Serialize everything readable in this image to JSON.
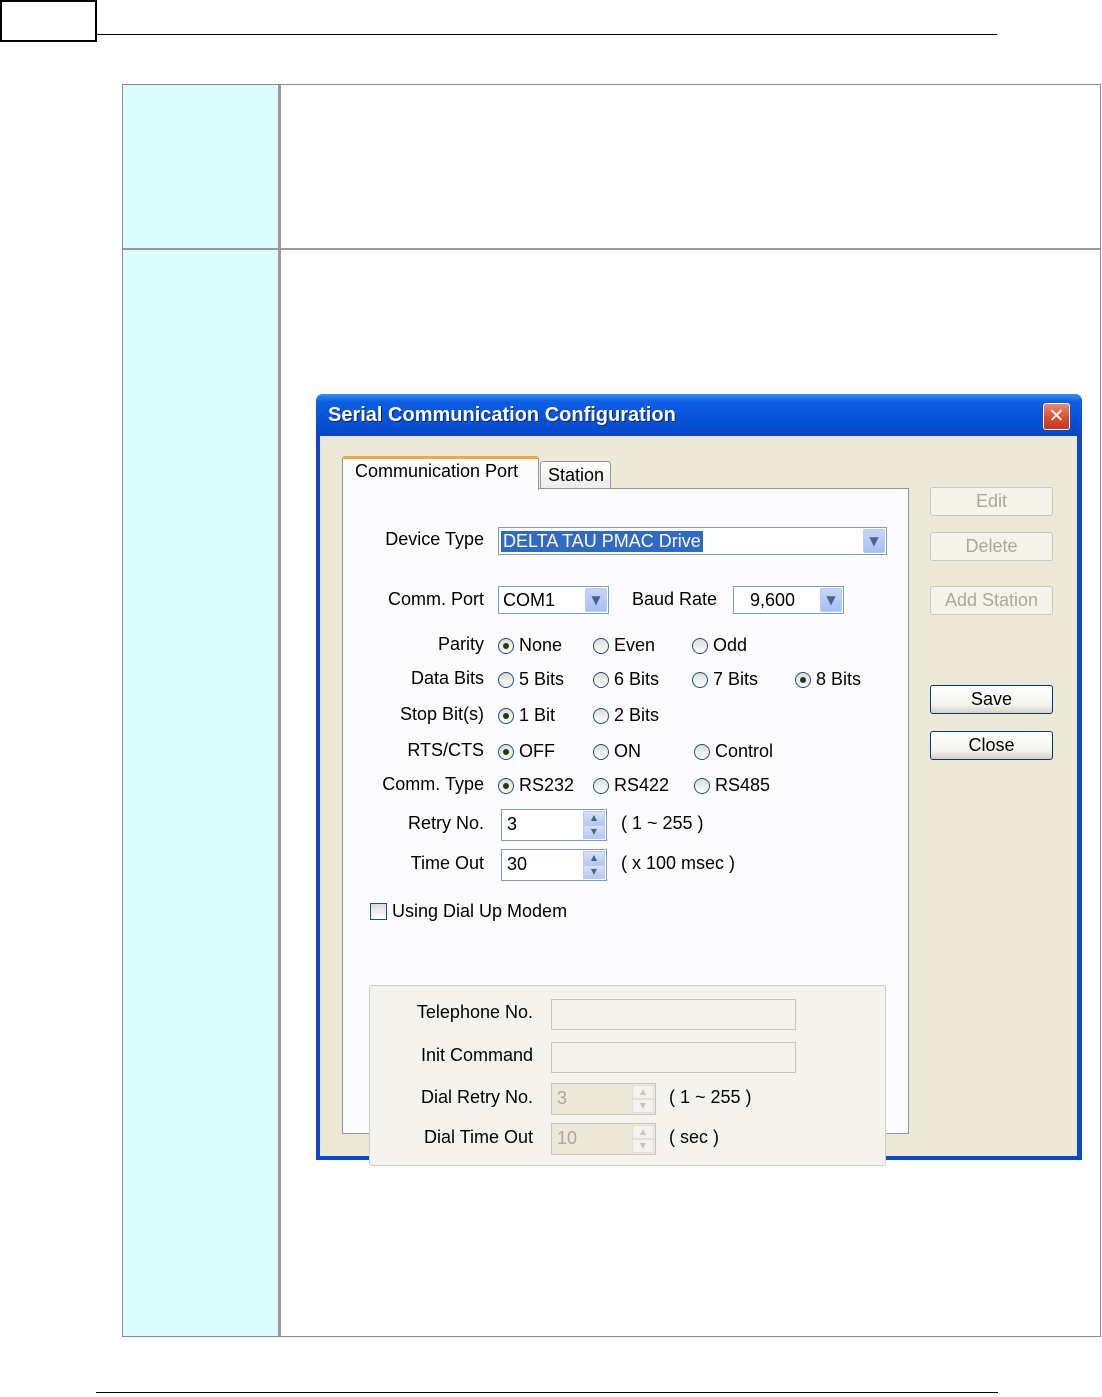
{
  "dialog": {
    "title": "Serial Communication Configuration",
    "close_glyph": "✕",
    "tabs": [
      "Communication Port",
      "Station"
    ],
    "device_type": {
      "label": "Device Type",
      "value": "DELTA TAU PMAC Drive"
    },
    "comm_port": {
      "label": "Comm. Port",
      "value": "COM1"
    },
    "baud_rate": {
      "label": "Baud Rate",
      "value": "9,600"
    },
    "parity": {
      "label": "Parity",
      "options": [
        "None",
        "Even",
        "Odd"
      ],
      "selected": "None"
    },
    "data_bits": {
      "label": "Data Bits",
      "options": [
        "5 Bits",
        "6 Bits",
        "7 Bits",
        "8 Bits"
      ],
      "selected": "8 Bits"
    },
    "stop_bits": {
      "label": "Stop Bit(s)",
      "options": [
        "1 Bit",
        "2 Bits"
      ],
      "selected": "1 Bit"
    },
    "rts_cts": {
      "label": "RTS/CTS",
      "options": [
        "OFF",
        "ON",
        "Control"
      ],
      "selected": "OFF"
    },
    "comm_type": {
      "label": "Comm. Type",
      "options": [
        "RS232",
        "RS422",
        "RS485"
      ],
      "selected": "RS232"
    },
    "retry_no": {
      "label": "Retry No.",
      "value": "3",
      "hint": "( 1 ~ 255 )"
    },
    "time_out": {
      "label": "Time Out",
      "value": "30",
      "hint": "( x 100 msec )"
    },
    "dial_up": {
      "checkbox_label": "Using Dial Up Modem",
      "checked": false,
      "telephone_label": "Telephone No.",
      "telephone_value": "",
      "init_label": "Init Command",
      "init_value": "",
      "dial_retry_label": "Dial Retry No.",
      "dial_retry_value": "3",
      "dial_retry_hint": "( 1 ~ 255 )",
      "dial_timeout_label": "Dial Time Out",
      "dial_timeout_value": "10",
      "dial_timeout_hint": "( sec )"
    },
    "buttons": {
      "edit": "Edit",
      "delete": "Delete",
      "add_station": "Add Station",
      "save": "Save",
      "close": "Close"
    }
  },
  "colors": {
    "table_left_column": "#dcfdfd",
    "title_bar": "#0a5fe6",
    "dialog_face": "#ece9d8",
    "tab_highlight": "#f2a93b",
    "selection": "#316ac5"
  }
}
